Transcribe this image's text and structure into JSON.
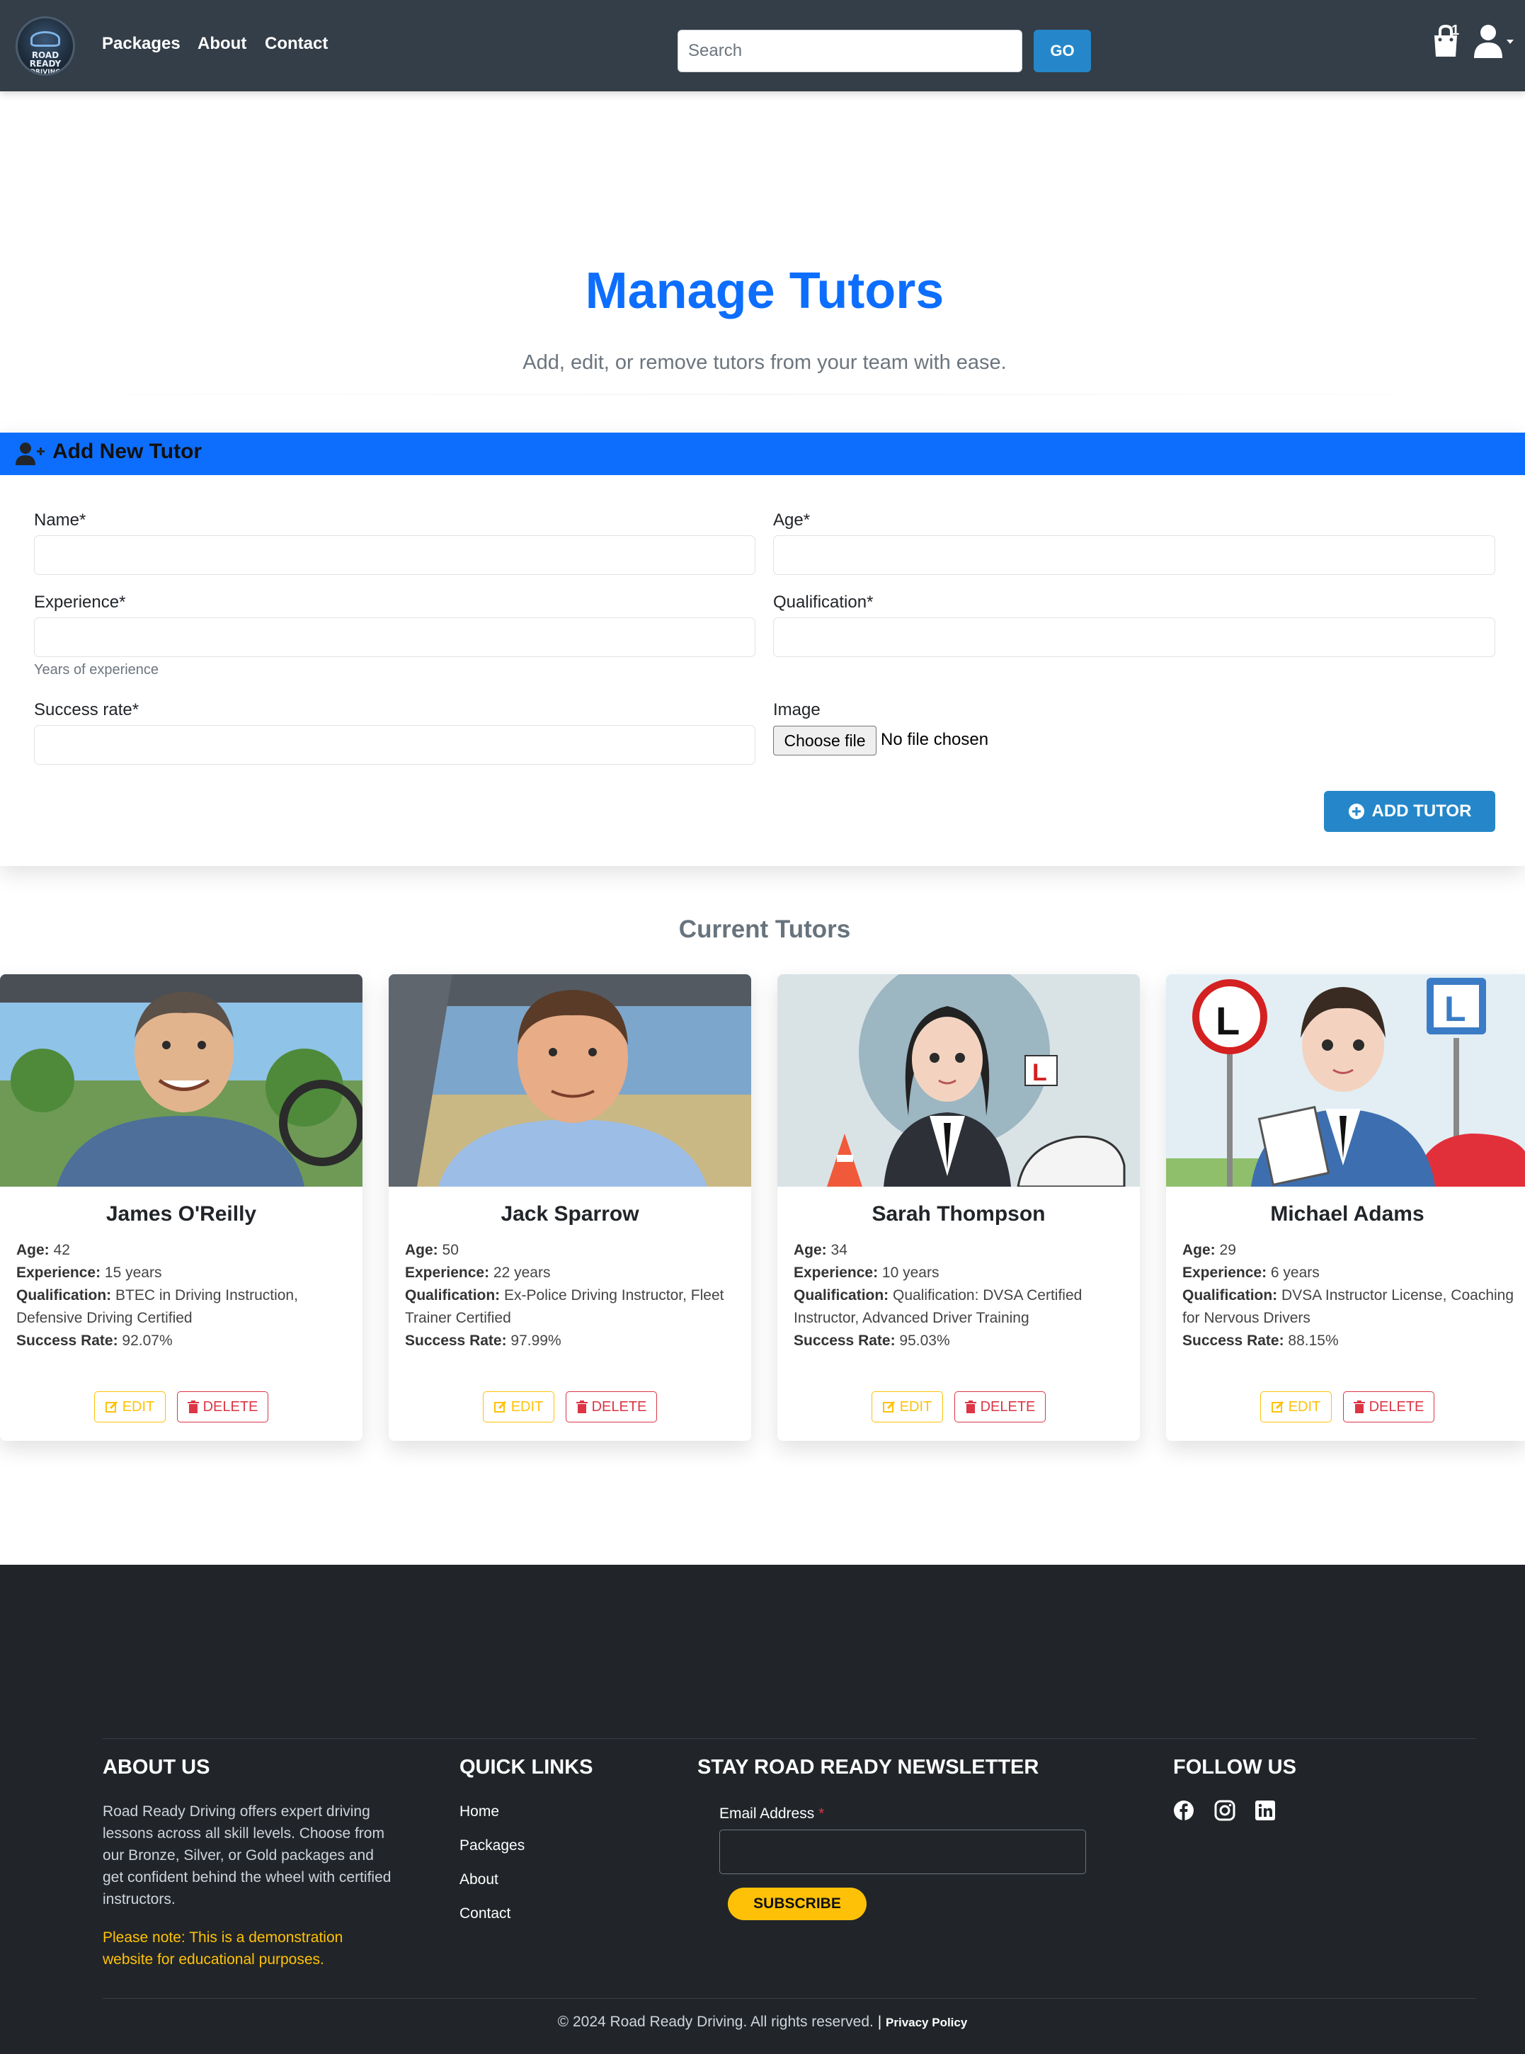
{
  "nav": {
    "logo_text_1": "ROAD READY",
    "logo_text_2": "DRIVING",
    "links": [
      "Packages",
      "About",
      "Contact"
    ],
    "search_placeholder": "Search",
    "go_label": "GO",
    "cart_count": "1"
  },
  "hero": {
    "title": "Manage Tutors",
    "subtitle": "Add, edit, or remove tutors from your team with ease."
  },
  "form": {
    "header": "Add New Tutor",
    "name_label": "Name*",
    "age_label": "Age*",
    "experience_label": "Experience*",
    "experience_help": "Years of experience",
    "qualification_label": "Qualification*",
    "success_label": "Success rate*",
    "image_label": "Image",
    "file_button": "Choose file",
    "file_status": "No file chosen",
    "submit_label": "ADD TUTOR"
  },
  "tutors_section": {
    "title": "Current Tutors",
    "age_label": "Age:",
    "experience_label": "Experience:",
    "qualification_label": "Qualification:",
    "success_label": "Success Rate:",
    "edit_label": "EDIT",
    "delete_label": "DELETE",
    "tutors": [
      {
        "name": "James O'Reilly",
        "age": "42",
        "experience": "15 years",
        "qualification": "BTEC in Driving Instruction, Defensive Driving Certified",
        "success_rate": "92.07%"
      },
      {
        "name": "Jack Sparrow",
        "age": "50",
        "experience": "22 years",
        "qualification": "Ex-Police Driving Instructor, Fleet Trainer Certified",
        "success_rate": "97.99%"
      },
      {
        "name": "Sarah Thompson",
        "age": "34",
        "experience": "10 years",
        "qualification": "Qualification: DVSA Certified Instructor, Advanced Driver Training",
        "success_rate": "95.03%"
      },
      {
        "name": "Michael Adams",
        "age": "29",
        "experience": "6 years",
        "qualification": "DVSA Instructor License, Coaching for Nervous Drivers",
        "success_rate": "88.15%"
      }
    ]
  },
  "footer": {
    "about_title": "ABOUT US",
    "about_text": "Road Ready Driving offers expert driving lessons across all skill levels. Choose from our Bronze, Silver, or Gold packages and get confident behind the wheel with certified instructors.",
    "about_note": "Please note: This is a demonstration website for educational purposes.",
    "links_title": "QUICK LINKS",
    "links": [
      "Home",
      "Packages",
      "About",
      "Contact"
    ],
    "newsletter_title": "STAY ROAD READY NEWSLETTER",
    "email_label": "Email Address",
    "email_required": "*",
    "subscribe_label": "SUBSCRIBE",
    "follow_title": "FOLLOW US",
    "copyright": "© 2024 Road Ready Driving. All rights reserved.",
    "separator": "|",
    "privacy": "Privacy Policy"
  },
  "colors": {
    "navbar": "#343e48",
    "primary": "#0d6efd",
    "button": "#2587c9",
    "footer": "#212529",
    "warning": "#ffc107",
    "danger": "#dc3545"
  }
}
